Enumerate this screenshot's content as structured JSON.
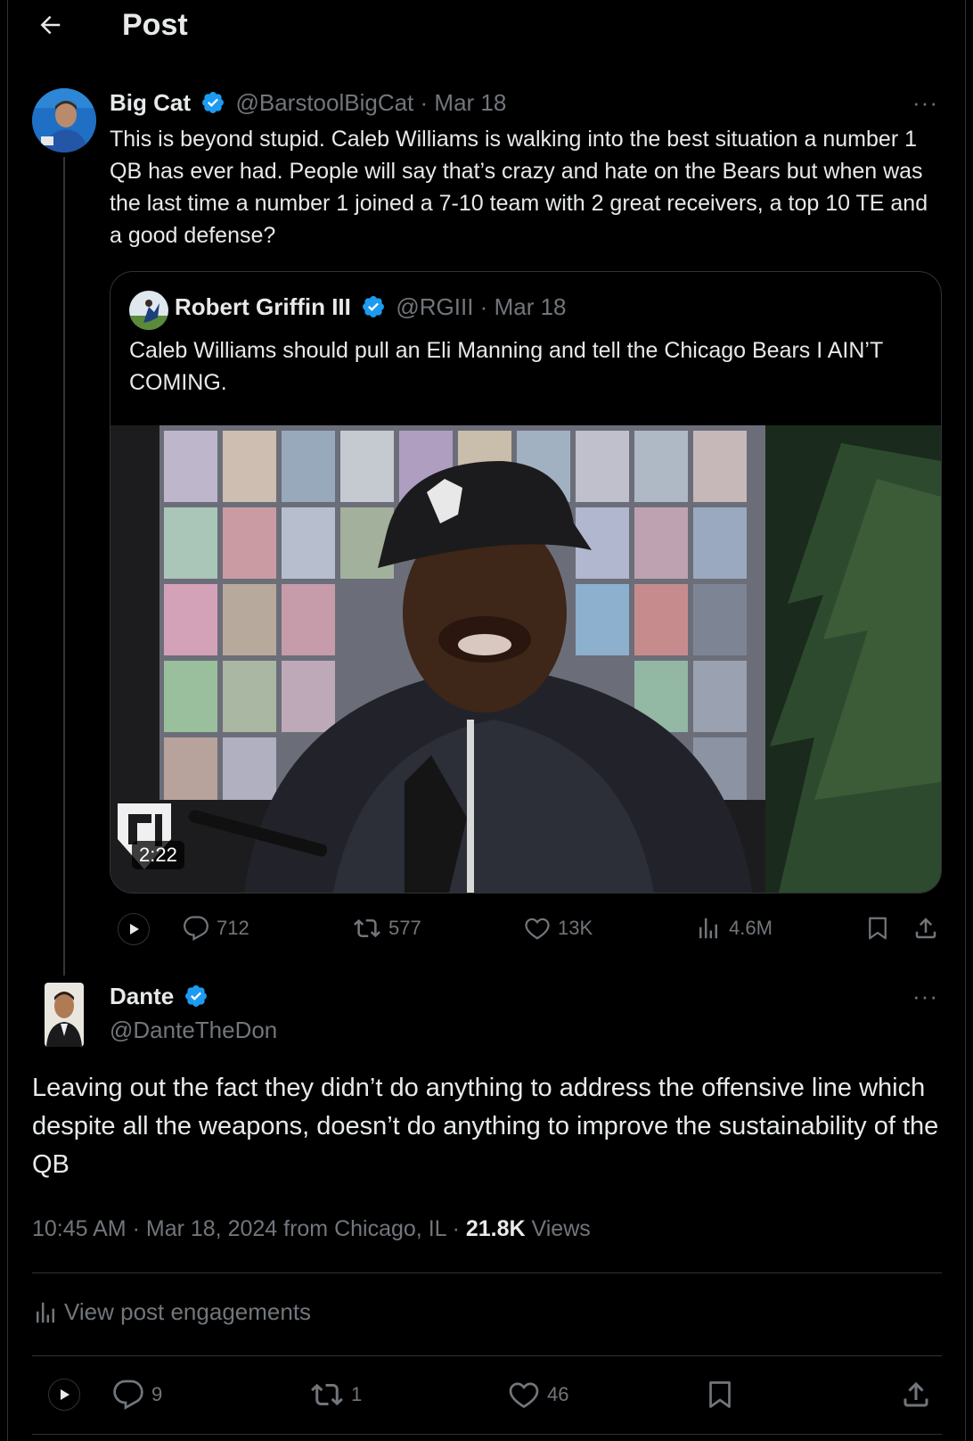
{
  "header": {
    "title": "Post"
  },
  "main_tweet": {
    "name": "Big Cat",
    "handle": "@BarstoolBigCat",
    "sep": "·",
    "date": "Mar 18",
    "text": "This is beyond stupid. Caleb Williams is walking into the best situation a number 1 QB has ever had. People will say that’s crazy and hate on the Bears but when was the last time a number 1 joined a 7-10 team with 2 great receivers, a top 10 TE and a good defense?",
    "more": "···"
  },
  "quote": {
    "name": "Robert Griffin III",
    "handle": "@RGIII",
    "sep": "·",
    "date": "Mar 18",
    "text": "Caleb Williams should pull an Eli Manning and tell the Chicago Bears I AIN’T COMING.",
    "video_duration": "2:22"
  },
  "main_actions": {
    "replies": "712",
    "reposts": "577",
    "likes": "13K",
    "views": "4.6M"
  },
  "reply": {
    "name": "Dante",
    "handle": "@DanteTheDon",
    "more": "···",
    "text": "Leaving out the fact they didn’t do anything to address the offensive line which despite all the weapons, doesn’t do anything to improve the sustainability of the QB",
    "time": "10:45 AM",
    "sep1": "·",
    "date": "Mar 18, 2024 from Chicago, IL",
    "sep2": "·",
    "views_count": "21.8K",
    "views_label": "Views",
    "engagements": "View post engagements",
    "replies": "9",
    "reposts": "1",
    "likes": "46"
  },
  "colors": {
    "background": "#000000",
    "text": "#e7e9ea",
    "muted": "#71767b",
    "verified": "#1d9bf0",
    "border": "#2f3336"
  }
}
